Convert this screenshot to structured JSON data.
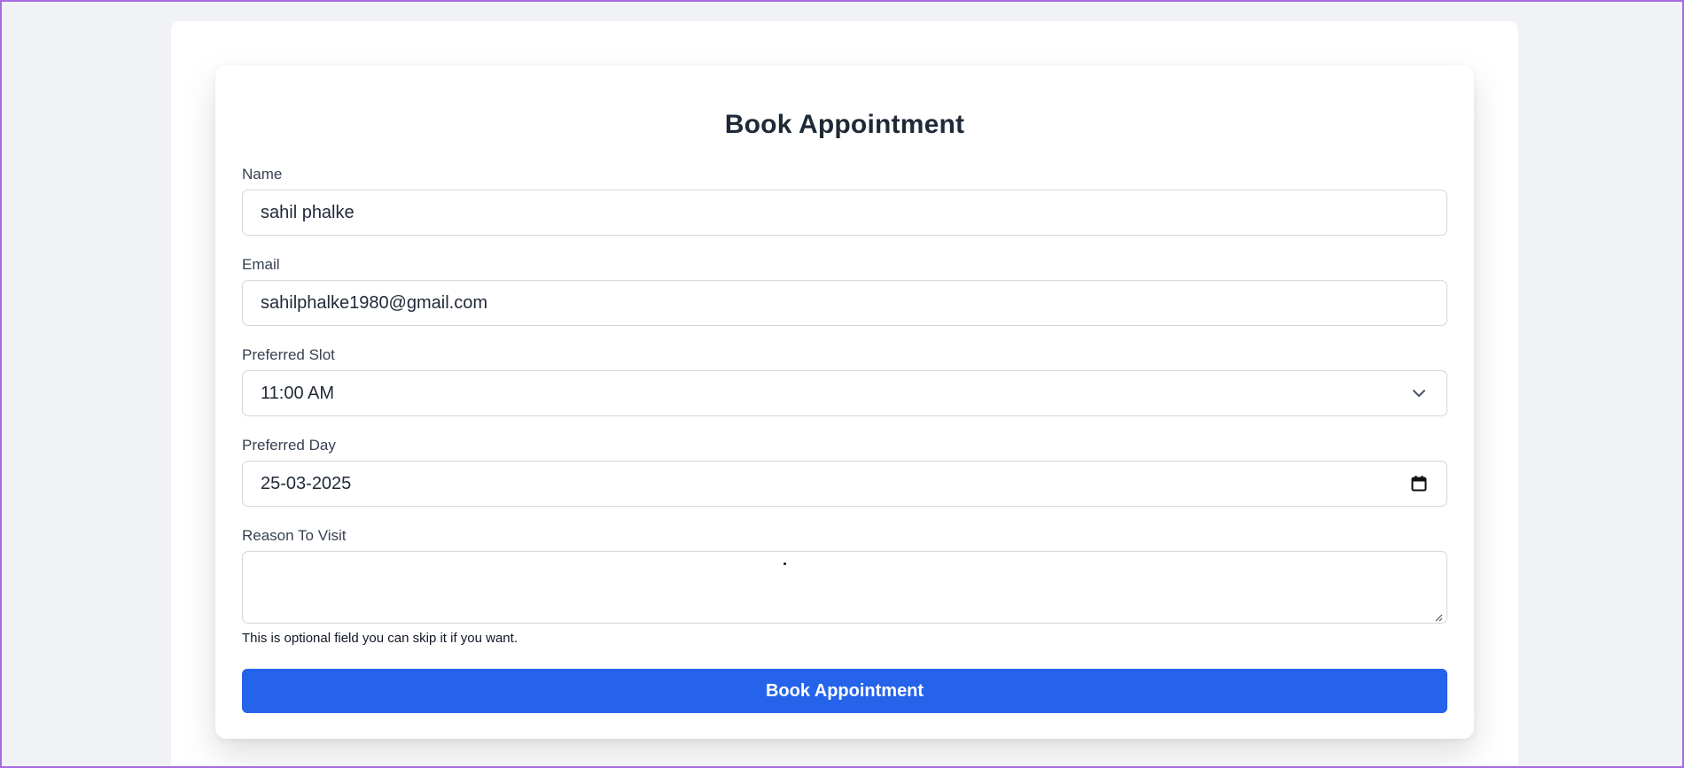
{
  "form": {
    "title": "Book Appointment",
    "name": {
      "label": "Name",
      "value": "sahil phalke"
    },
    "email": {
      "label": "Email",
      "value": "sahilphalke1980@gmail.com"
    },
    "slot": {
      "label": "Preferred Slot",
      "value": "11:00 AM",
      "icon": "chevron-down-icon"
    },
    "day": {
      "label": "Preferred Day",
      "value": "25-03-2025",
      "icon": "calendar-icon"
    },
    "reason": {
      "label": "Reason To Visit",
      "value": "",
      "help": "This is optional field you can skip it if you want."
    },
    "submit_label": "Book Appointment"
  },
  "colors": {
    "page_background": "#f1f2f5",
    "card_background": "#ffffff",
    "primary_button": "#2563eb",
    "border": "#d4d7dd",
    "frame": "#a66be0"
  }
}
